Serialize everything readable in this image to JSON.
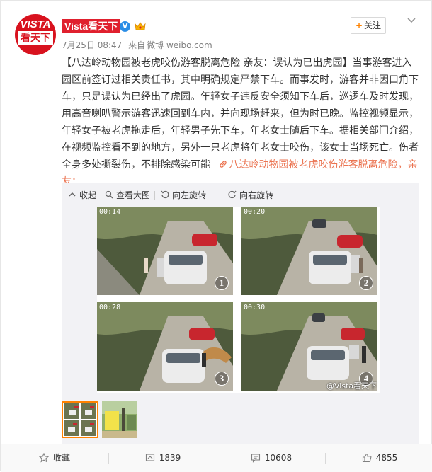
{
  "post": {
    "author": "Vista看天下",
    "avatar": {
      "top": "VISTA",
      "bottom": "看天下"
    },
    "verified_mark": "V",
    "time": "7月25日 08:47",
    "source_prefix": "来自",
    "source": "微博 weibo.com",
    "follow_label": "关注",
    "follow_plus": "+",
    "text_main": "【八达岭动物园被老虎咬伤游客脱离危险 亲友：误认为已出虎园】当事游客进入园区前签订过相关责任书，其中明确规定严禁下车。而事发时，游客并非因口角下车，只是误认为已经出了虎园。年轻女子违反安全须知下车后，巡逻车及时发现，用高音喇叭警示游客迅速回到车内，并向现场赶来，但为时已晚。监控视频显示，年轻女子被老虎拖走后，年轻男子先下车，年老女士随后下车。据相关部门介绍，在视频监控看不到的地方，另外一只老虎将年老女士咬伤，该女士当场死亡。伤者全身多处撕裂伤，不排除感染可能",
    "text_link": "八达岭动物园被老虎咬伤游客脱离危险，亲友：..."
  },
  "toolbar": {
    "collapse": "收起",
    "view_large": "查看大图",
    "rotate_left": "向左旋转",
    "rotate_right": "向右旋转"
  },
  "image": {
    "panels": [
      {
        "timestamp": "00:14",
        "number": "1"
      },
      {
        "timestamp": "00:20",
        "number": "2"
      },
      {
        "timestamp": "00:28",
        "number": "3"
      },
      {
        "timestamp": "00:30",
        "number": "4"
      }
    ],
    "watermark": "@Vista看天下"
  },
  "footer": {
    "favorite": "收藏",
    "forward_count": "1839",
    "comment_count": "10608",
    "like_count": "4855"
  },
  "colors": {
    "brand_red": "#e0202e",
    "accent_orange": "#ff8200",
    "link": "#eb7350",
    "verified_blue": "#2a8de6"
  },
  "icons": [
    "verified-icon",
    "vip-icon",
    "chevron-down-icon",
    "collapse-icon",
    "zoom-icon",
    "rotate-left-icon",
    "rotate-right-icon",
    "star-icon",
    "forward-icon",
    "comment-icon",
    "like-icon",
    "link-icon"
  ]
}
